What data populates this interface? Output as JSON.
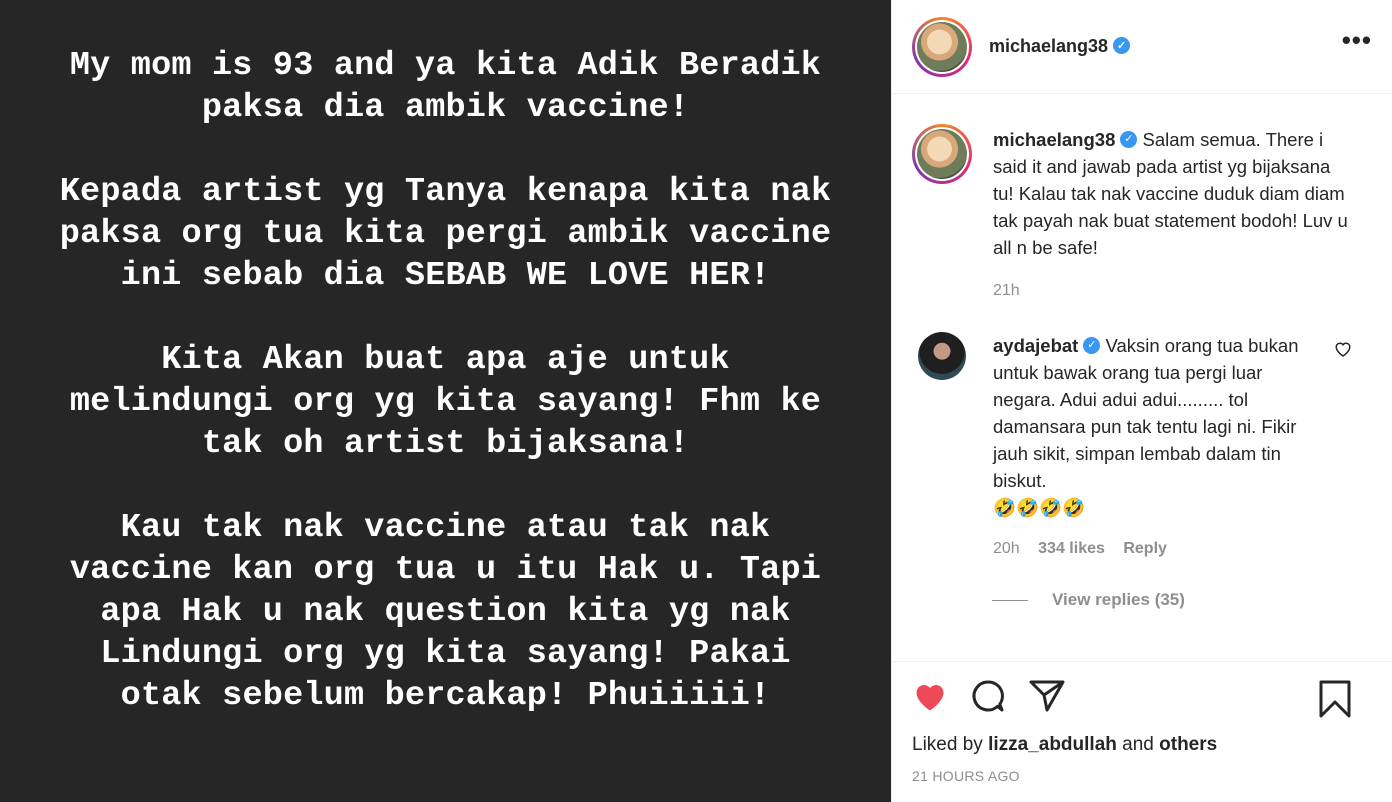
{
  "story": {
    "text": "My mom is 93 and ya kita Adik Beradik\npaksa dia ambik vaccine!\n\nKepada artist yg Tanya kenapa kita nak\npaksa org tua kita pergi ambik vaccine\nini sebab dia SEBAB WE LOVE HER!\n\nKita Akan buat apa aje untuk\nmelindungi org yg kita sayang! Fhm ke\ntak oh artist bijaksana!\n\nKau tak nak vaccine atau tak nak\nvaccine kan org tua u itu Hak u. Tapi\napa Hak u nak question kita yg nak\nLindungi org yg kita sayang! Pakai\notak sebelum bercakap! Phuiiiii!"
  },
  "header": {
    "username": "michaelang38",
    "more": "•••"
  },
  "caption": {
    "username": "michaelang38",
    "text": "Salam semua. There i said it and jawab pada artist yg bijaksana tu! Kalau tak nak vaccine duduk diam diam tak payah nak buat statement bodoh! Luv u all n be safe!",
    "time": "21h"
  },
  "comment": {
    "username": "aydajebat",
    "text": "Vaksin orang tua bukan untuk bawak orang tua pergi luar negara. Adui adui adui......... tol damansara pun tak tentu lagi ni. Fikir jauh sikit, simpan lembab dalam tin biskut.",
    "emoji": "🤣🤣🤣🤣",
    "time": "20h",
    "likes": "334 likes",
    "reply": "Reply",
    "view_replies": "View replies (35)"
  },
  "footer": {
    "liked_prefix": "Liked by",
    "liked_user": "lizza_abdullah",
    "liked_and": "and",
    "liked_others": "others",
    "timestamp": "21 HOURS AGO"
  },
  "colors": {
    "heart": "#ed4956",
    "verified": "#3897f0",
    "media_bg": "#262626"
  }
}
